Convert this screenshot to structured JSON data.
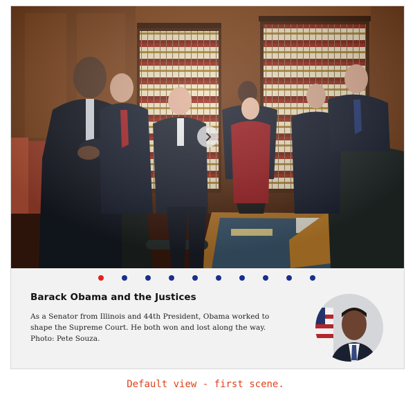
{
  "carousel": {
    "slide": {
      "title": "Barack Obama and the Justices",
      "description": "As a Senator from Illinois and 44th President, Obama worked to shape the Supreme Court. He both won and lost along the way. Photo: Pete Souza.",
      "image_icon": "group-photo",
      "portrait_icon": "portrait-photo"
    },
    "next_icon": "chevron-right-icon",
    "pagination": {
      "total": 10,
      "active_index": 0,
      "active_color": "#e3211f",
      "inactive_color": "#1b2e8c"
    }
  },
  "footer": {
    "label": "Default view - first scene."
  },
  "colors": {
    "caption_background": "#f2f2f2",
    "footer_text": "#e0421b"
  }
}
